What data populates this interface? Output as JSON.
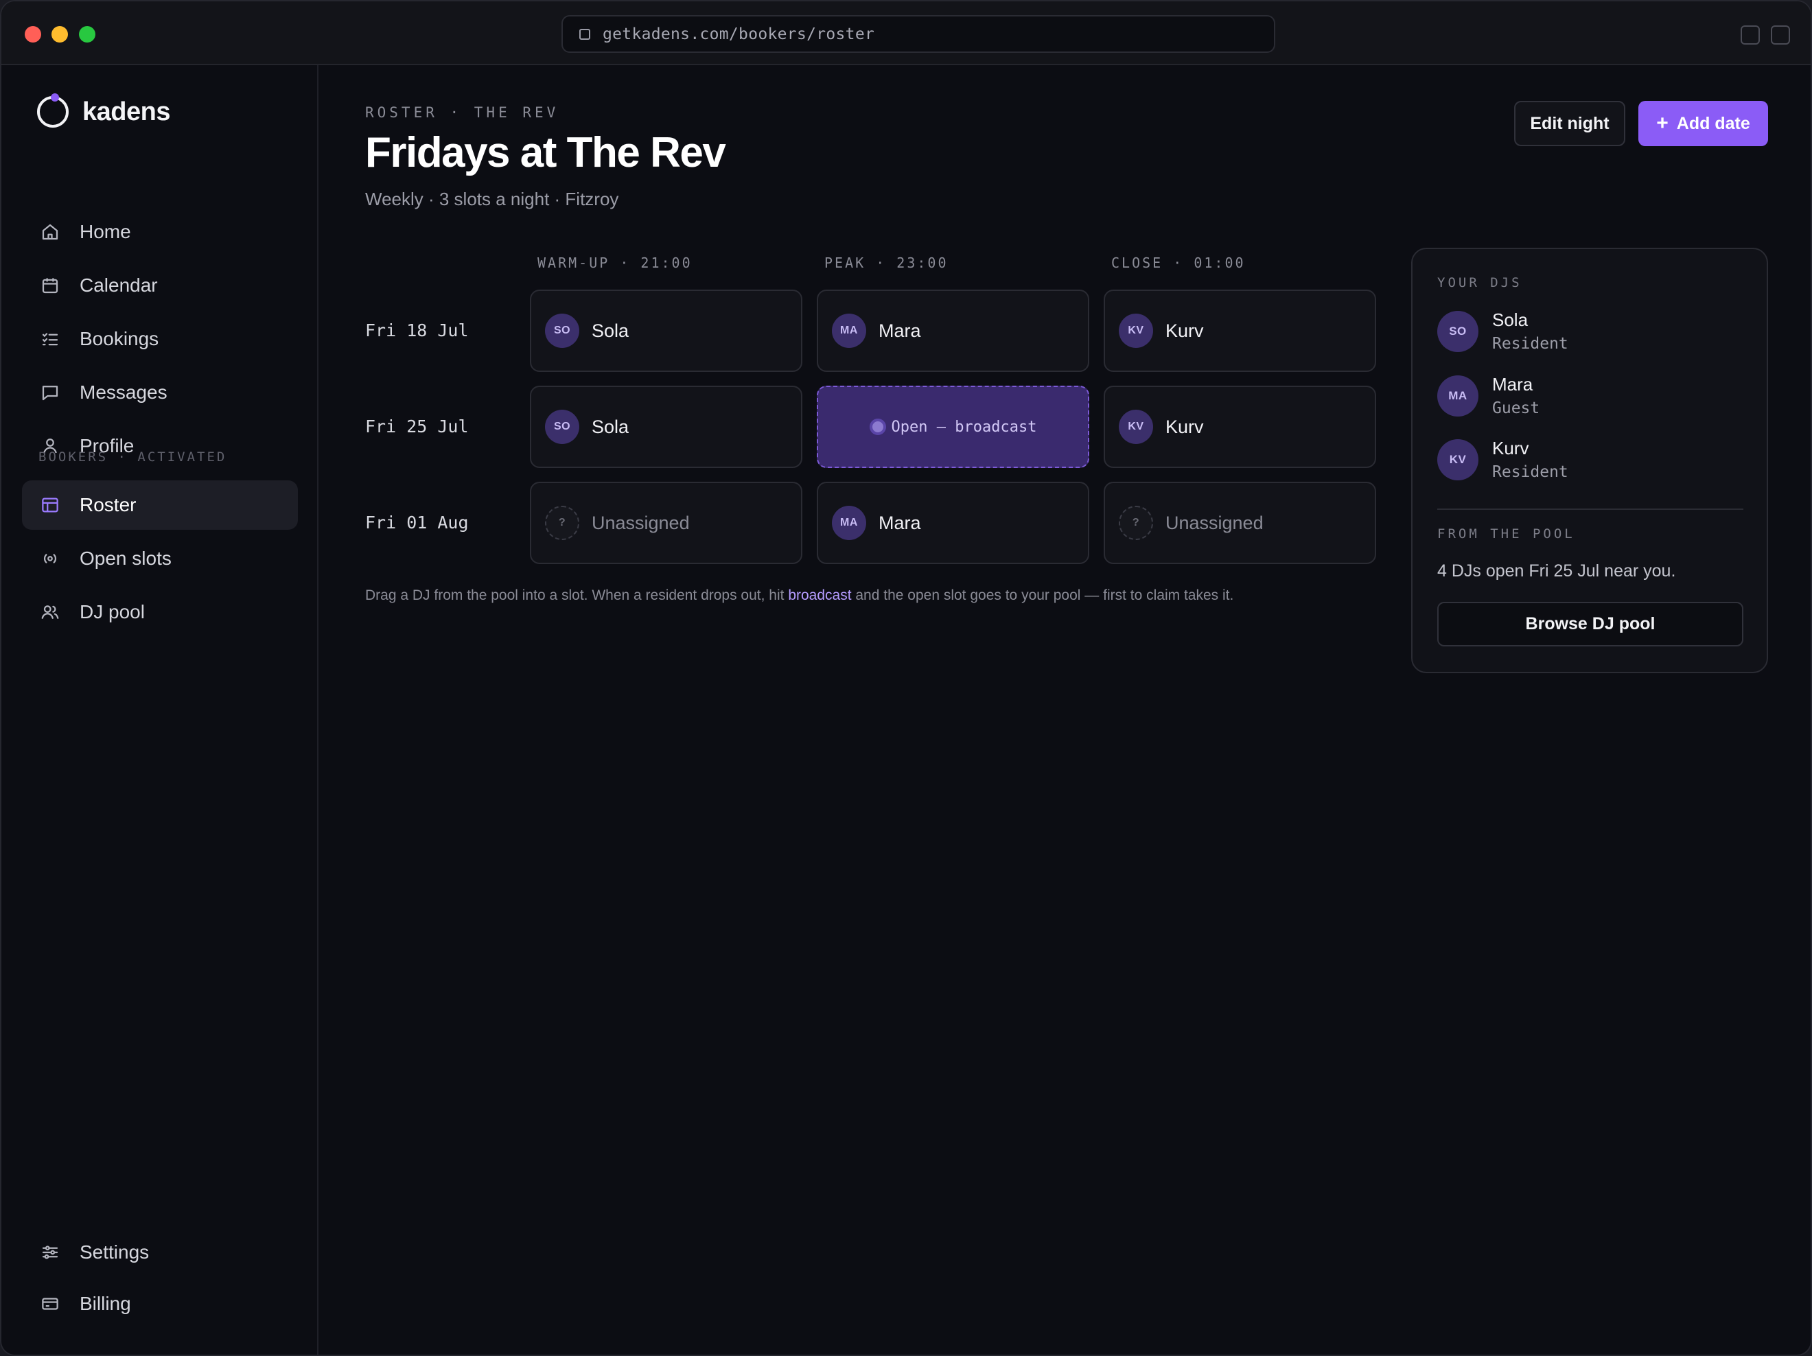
{
  "browser": {
    "url": "getkadens.com/bookers/roster"
  },
  "brand": {
    "name": "kadens",
    "accent": "#8b5cf6"
  },
  "sidebar": {
    "items": [
      {
        "label": "Home",
        "icon": "home-icon"
      },
      {
        "label": "Calendar",
        "icon": "calendar-icon"
      },
      {
        "label": "Bookings",
        "icon": "list-icon"
      },
      {
        "label": "Messages",
        "icon": "message-icon"
      },
      {
        "label": "Profile",
        "icon": "user-icon"
      }
    ],
    "section_label": "BOOKERS · ACTIVATED",
    "booker_items": [
      {
        "label": "Roster",
        "icon": "roster-icon",
        "active": true
      },
      {
        "label": "Open slots",
        "icon": "broadcast-icon"
      },
      {
        "label": "DJ pool",
        "icon": "users-icon"
      }
    ],
    "bottom_items": [
      {
        "label": "Settings",
        "icon": "sliders-icon"
      },
      {
        "label": "Billing",
        "icon": "card-icon"
      }
    ]
  },
  "header": {
    "breadcrumb": "ROSTER · THE REV",
    "title": "Fridays at The Rev",
    "subtitle": "Weekly · 3 slots a night · Fitzroy",
    "edit_label": "Edit night",
    "add_label": "Add date"
  },
  "grid": {
    "columns": [
      "WARM-UP · 21:00",
      "PEAK · 23:00",
      "CLOSE · 01:00"
    ],
    "rows": [
      {
        "date": "Fri 18 Jul",
        "slots": [
          {
            "initials": "SO",
            "name": "Sola"
          },
          {
            "initials": "MA",
            "name": "Mara"
          },
          {
            "initials": "KV",
            "name": "Kurv"
          }
        ]
      },
      {
        "date": "Fri 25 Jul",
        "slots": [
          {
            "initials": "SO",
            "name": "Sola"
          },
          {
            "open_text": "Open — broadcast"
          },
          {
            "initials": "KV",
            "name": "Kurv"
          }
        ]
      },
      {
        "date": "Fri 01 Aug",
        "slots": [
          {
            "initials": "?",
            "name": "Unassigned"
          },
          {
            "initials": "MA",
            "name": "Mara"
          },
          {
            "initials": "?",
            "name": "Unassigned"
          }
        ]
      }
    ]
  },
  "hint": {
    "before": "Drag a DJ from the pool into a slot. When a resident drops out, hit ",
    "link": "broadcast",
    "after": " and the open slot goes to your pool — first to claim takes it."
  },
  "panel": {
    "your_djs_label": "YOUR DJS",
    "djs": [
      {
        "initials": "SO",
        "name": "Sola",
        "role": "Resident"
      },
      {
        "initials": "MA",
        "name": "Mara",
        "role": "Guest"
      },
      {
        "initials": "KV",
        "name": "Kurv",
        "role": "Resident"
      }
    ],
    "pool_label": "FROM THE POOL",
    "pool_text": "4 DJs open Fri 25 Jul near you.",
    "browse_label": "Browse DJ pool"
  }
}
